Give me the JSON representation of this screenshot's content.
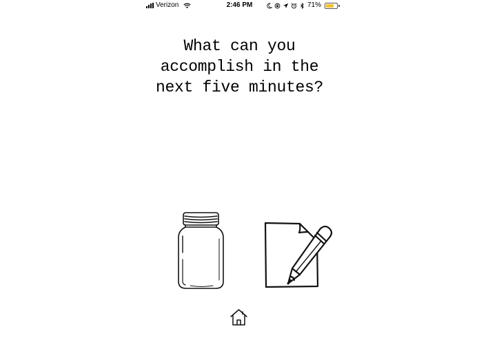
{
  "status_bar": {
    "carrier": "Verizon",
    "time": "2:46 PM",
    "battery_percent": "71%",
    "battery_level": 0.71,
    "battery_color": "#f2c12e",
    "icons": [
      "signal-icon",
      "wifi-icon",
      "moon-icon",
      "rotation-lock-icon",
      "location-icon",
      "alarm-icon",
      "bluetooth-icon",
      "battery-icon"
    ]
  },
  "prompt": {
    "lines": [
      "What can you",
      "accomplish in the",
      "next five minutes?"
    ]
  },
  "actions": {
    "jar": "jar-icon",
    "note": "paper-and-pencil-icon",
    "home": "home-icon"
  }
}
